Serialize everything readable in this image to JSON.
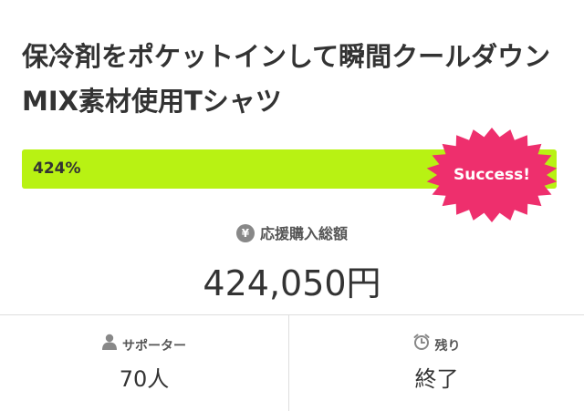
{
  "project": {
    "title": "保冷剤をポケットインして瞬間クールダウンMIX素材使用Tシャツ"
  },
  "progress": {
    "percent_label": "424%",
    "fill_fraction": 1.0,
    "badge": "Success!",
    "colors": {
      "fill": "#b8f213",
      "badge": "#ee2f6d"
    }
  },
  "funding": {
    "icon": "yen-icon",
    "icon_glyph": "¥",
    "label": "応援購入総額",
    "amount": "424,050円"
  },
  "supporters": {
    "icon": "person-icon",
    "label": "サポーター",
    "value": "70人"
  },
  "remaining": {
    "icon": "clock-icon",
    "label": "残り",
    "value": "終了"
  }
}
